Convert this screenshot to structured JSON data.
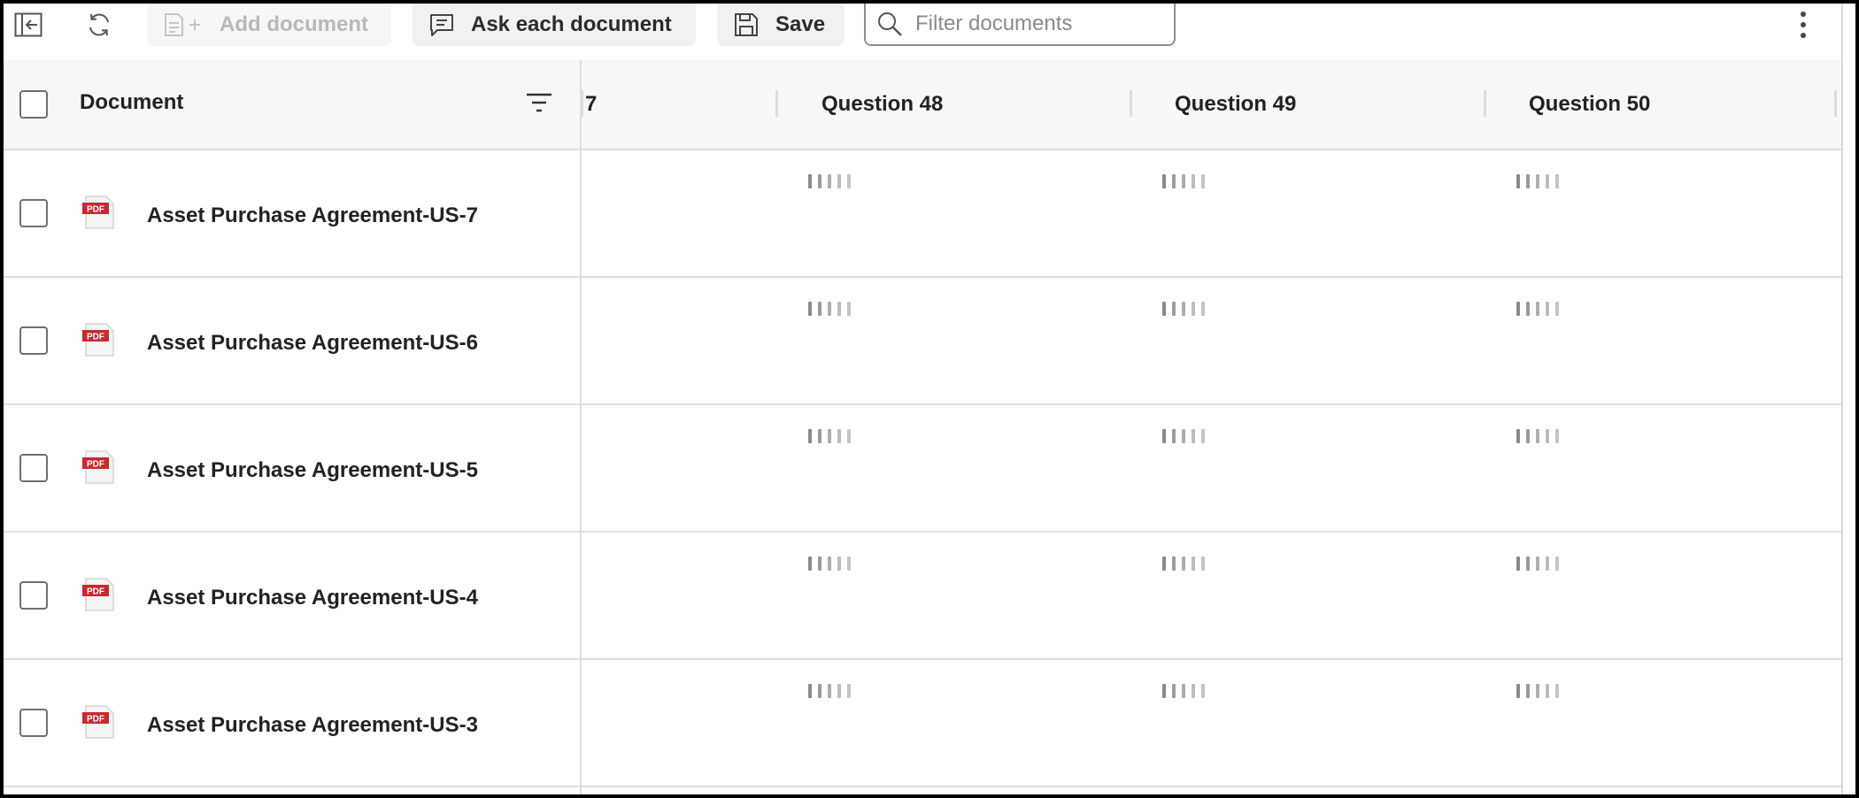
{
  "toolbar": {
    "add_document_label": "Add document",
    "ask_each_label": "Ask each document",
    "save_label": "Save",
    "filter_placeholder": "Filter documents"
  },
  "table": {
    "document_column_label": "Document",
    "partial_column_label": "7",
    "question_columns": [
      "Question 48",
      "Question 49",
      "Question 50"
    ],
    "rows": [
      {
        "name": "Asset Purchase Agreement-US-7",
        "file_type": "PDF"
      },
      {
        "name": "Asset Purchase Agreement-US-6",
        "file_type": "PDF"
      },
      {
        "name": "Asset Purchase Agreement-US-5",
        "file_type": "PDF"
      },
      {
        "name": "Asset Purchase Agreement-US-4",
        "file_type": "PDF"
      },
      {
        "name": "Asset Purchase Agreement-US-3",
        "file_type": "PDF"
      }
    ]
  },
  "icons": {
    "collapse_sidebar": "collapse-sidebar-icon",
    "refresh": "refresh-icon",
    "add_document": "add-document-icon",
    "chat": "chat-icon",
    "save": "floppy-disk-icon",
    "search": "search-icon",
    "more": "kebab-menu-icon",
    "sort": "sort-filter-icon",
    "pdf": "pdf-file-icon",
    "loading": "loading-bars-icon"
  },
  "colors": {
    "pdf_red": "#c8292e",
    "loader_gray": "#a9a9a9",
    "header_bg": "#f7f7f7"
  }
}
